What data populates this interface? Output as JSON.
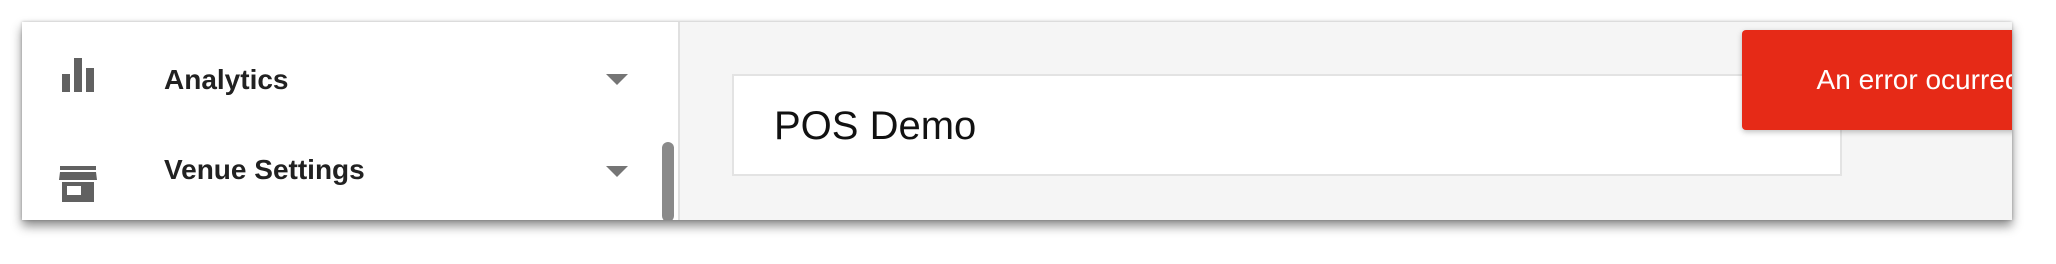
{
  "sidebar": {
    "items": [
      {
        "label": "Analytics",
        "icon": "bar-chart-icon"
      },
      {
        "label": "Venue Settings",
        "icon": "storefront-icon"
      }
    ]
  },
  "main": {
    "name_field": {
      "value": "POS Demo"
    }
  },
  "toast": {
    "message": "An error ocurred updating the menu, please contact support",
    "color": "#e62a17"
  },
  "colors": {
    "icon": "#616161",
    "chevron": "#757575",
    "background": "#f5f5f5"
  }
}
